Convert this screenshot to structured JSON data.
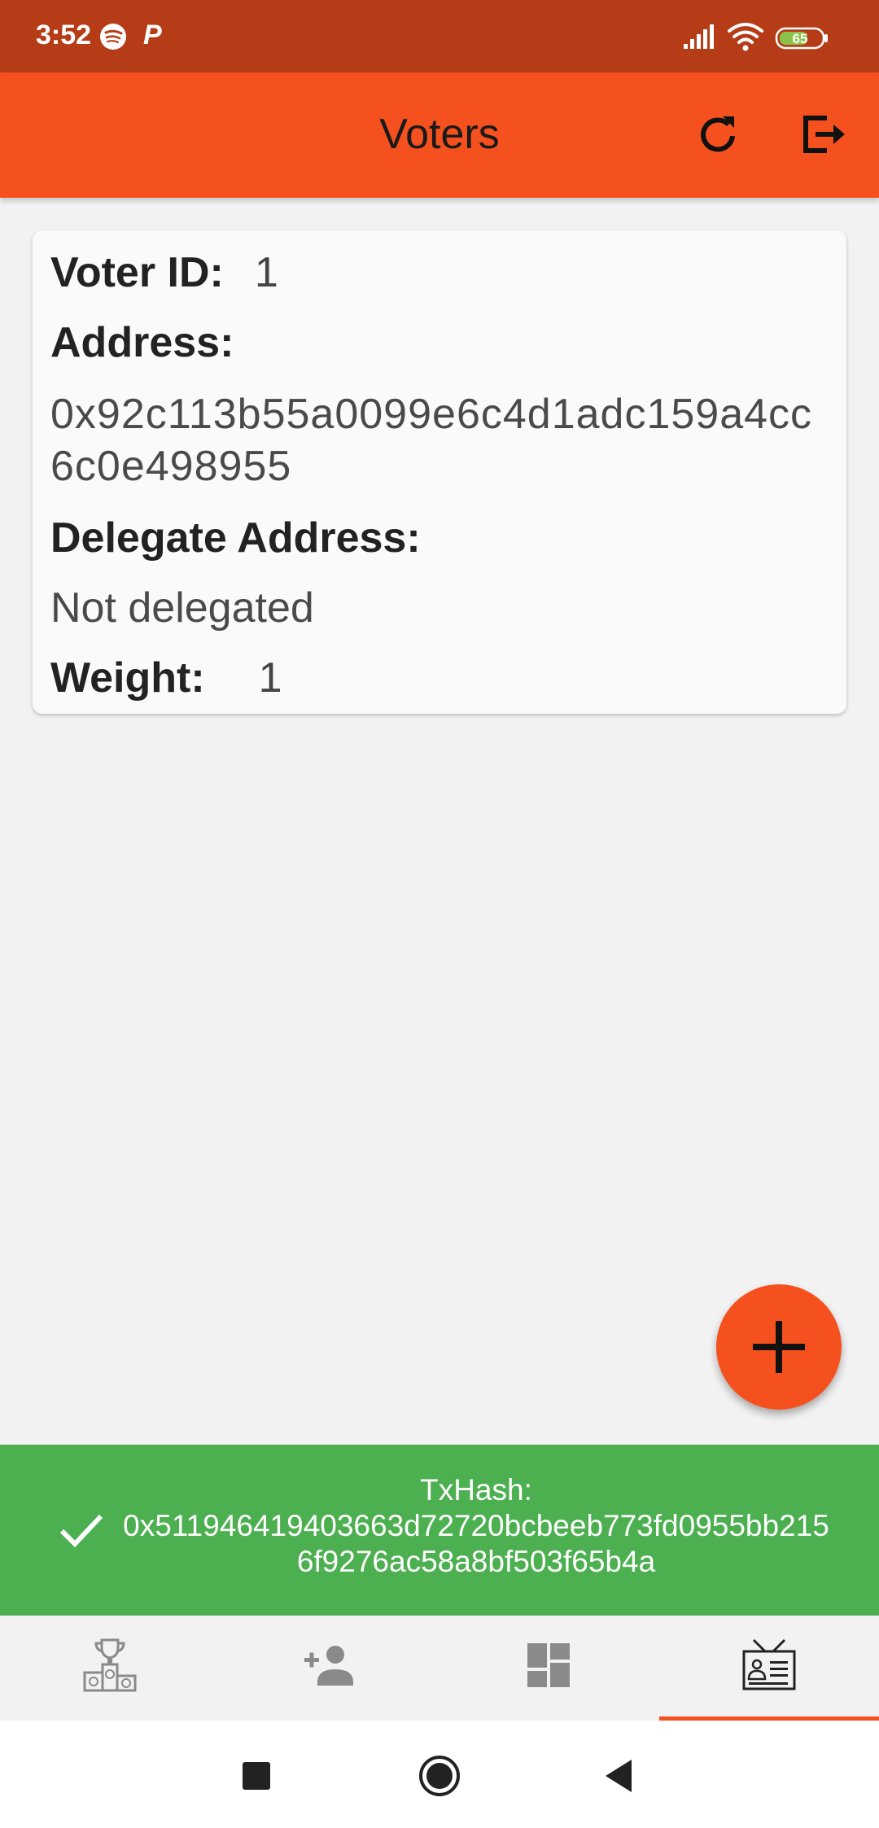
{
  "status_bar": {
    "time": "3:52",
    "p_label": "P",
    "battery": "65",
    "icons": [
      "spotify-icon",
      "p-icon",
      "signal-icon",
      "wifi-icon",
      "battery-icon"
    ]
  },
  "app_bar": {
    "title": "Voters",
    "actions": [
      "refresh-icon",
      "logout-icon"
    ]
  },
  "voter_card": {
    "voter_id_label": "Voter ID:",
    "voter_id_value": "1",
    "address_label": "Address:",
    "address_value": "0x92c113b55a0099e6c4d1adc159a4cc6c0e498955",
    "delegate_label": "Delegate Address:",
    "delegate_value": "Not delegated",
    "weight_label": "Weight:",
    "weight_value": "1"
  },
  "fab": {
    "icon": "plus-icon"
  },
  "snackbar": {
    "title": "TxHash:",
    "hash": "0x511946419403663d72720bcbeeb773fd0955bb2156f9276ac58a8bf503f65b4a",
    "icon": "check-icon"
  },
  "bottom_nav": {
    "items": [
      "podium-icon",
      "add-person-icon",
      "dashboard-icon",
      "voter-card-icon"
    ],
    "active_index": 3
  },
  "colors": {
    "status_bar": "#b63c18",
    "primary": "#f5511e",
    "snackbar": "#4caf50",
    "background": "#f2f2f2"
  }
}
